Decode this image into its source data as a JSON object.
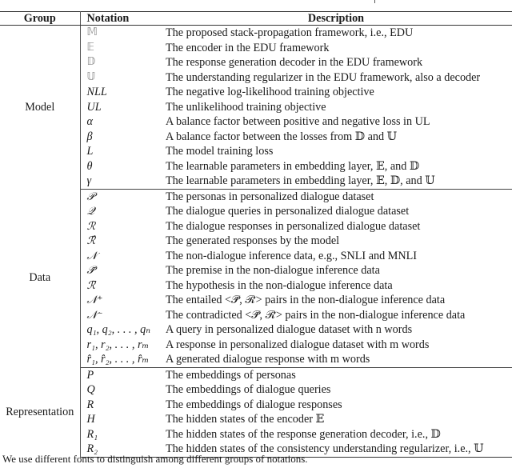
{
  "table": {
    "headers": {
      "group": "Group",
      "notation": "Notation",
      "description": "Description"
    },
    "groups": [
      {
        "name": "Model",
        "rows": [
          {
            "notation": "𝕄",
            "style": "bb",
            "description": "The proposed stack-propagation framework, i.e., EDU"
          },
          {
            "notation": "𝔼",
            "style": "bb",
            "description": "The encoder in the EDU framework"
          },
          {
            "notation": "𝔻",
            "style": "bb",
            "description": "The response generation decoder in the EDU framework"
          },
          {
            "notation": "𝕌",
            "style": "bb",
            "description": "The understanding regularizer in the EDU framework, also a decoder"
          },
          {
            "notation": "NLL",
            "style": "italic",
            "description": "The negative log-likelihood training objective"
          },
          {
            "notation": "UL",
            "style": "italic",
            "description": "The unlikelihood training objective"
          },
          {
            "notation": "α",
            "style": "italic",
            "description": "A balance factor between positive and negative loss in UL"
          },
          {
            "notation": "β",
            "style": "italic",
            "description": "A balance factor between the losses from 𝔻 and 𝕌"
          },
          {
            "notation": "L",
            "style": "italic",
            "description": "The model training loss"
          },
          {
            "notation": "θ",
            "style": "italic",
            "description": "The learnable parameters in embedding layer, 𝔼, and 𝔻"
          },
          {
            "notation": "γ",
            "style": "italic",
            "description": "The learnable parameters in embedding layer, 𝔼, 𝔻, and 𝕌"
          }
        ]
      },
      {
        "name": "Data",
        "rows": [
          {
            "notation": "𝒫",
            "style": "cal",
            "description": "The personas in personalized dialogue dataset"
          },
          {
            "notation": "𝒬",
            "style": "cal",
            "description": "The dialogue queries in personalized dialogue dataset"
          },
          {
            "notation": "ℛ",
            "style": "cal",
            "description": "The dialogue responses in personalized dialogue dataset"
          },
          {
            "notation": "ℛ̂",
            "style": "cal",
            "description": "The generated responses by the model"
          },
          {
            "notation": "𝒩",
            "style": "cal",
            "description": "The non-dialogue inference data, e.g., SNLI and MNLI"
          },
          {
            "notation": "𝒫̄",
            "style": "cal",
            "description": "The premise in the non-dialogue inference data"
          },
          {
            "notation": "ℛ̄",
            "style": "cal",
            "description": "The hypothesis in the non-dialogue inference data"
          },
          {
            "notation": "𝒩⁺",
            "style": "cal",
            "description": "The entailed <𝒫̄, ℛ̄> pairs in the non-dialogue inference data"
          },
          {
            "notation": "𝒩⁻",
            "style": "cal",
            "description": "The contradicted <𝒫̄, ℛ̄> pairs in the non-dialogue inference data"
          },
          {
            "notation": "q₁, q₂, . . . , qₙ",
            "style": "italic",
            "description": "A query in personalized dialogue dataset with n words"
          },
          {
            "notation": "r₁, r₂, . . . , rₘ",
            "style": "italic",
            "description": "A response in personalized dialogue dataset with m words"
          },
          {
            "notation": "r̂₁, r̂₂, . . . , r̂ₘ",
            "style": "italic",
            "description": "A generated dialogue response with m words"
          }
        ]
      },
      {
        "name": "Representation",
        "rows": [
          {
            "notation": "P",
            "style": "italic",
            "description": "The embeddings of personas"
          },
          {
            "notation": "Q",
            "style": "italic",
            "description": "The embeddings of dialogue queries"
          },
          {
            "notation": "R",
            "style": "italic",
            "description": "The embeddings of dialogue responses"
          },
          {
            "notation": "H",
            "style": "italic",
            "description": "The hidden states of the encoder 𝔼"
          },
          {
            "notation": "R₁",
            "style": "italic",
            "description": "The hidden states of the response generation decoder, i.e., 𝔻"
          },
          {
            "notation": "R₂",
            "style": "italic",
            "description": "The hidden states of the consistency understanding regularizer, i.e., 𝕌"
          }
        ]
      }
    ]
  },
  "caption": "We use different fonts to distinguish among different groups of notations."
}
